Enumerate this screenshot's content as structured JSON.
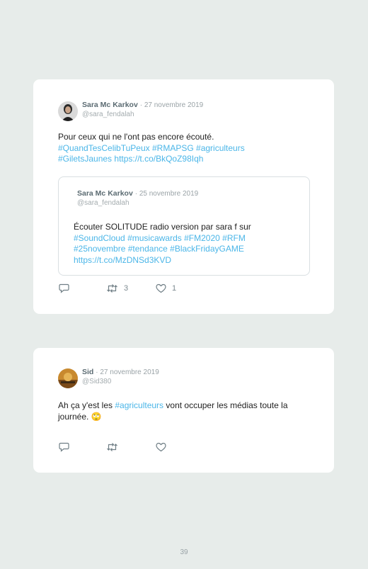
{
  "tweet1": {
    "name": "Sara Mc Karkov",
    "date": "· 27 novembre 2019",
    "handle": "@sara_fendalah",
    "text": "Pour ceux qui ne l'ont pas encore écouté.",
    "links": [
      "#QuandTesCelibTuPeux",
      "#RMAPSG",
      "#agriculteurs",
      "#GiletsJaunes",
      "https://t.co/BkQoZ98Iqh"
    ],
    "quoted": {
      "name": "Sara Mc Karkov",
      "date": "· 25 novembre 2019",
      "handle": "@sara_fendalah",
      "text": "Écouter SOLITUDE radio version par sara f sur",
      "links": [
        "#SoundCloud",
        "#musicawards",
        "#FM2020",
        "#RFM",
        "#25novembre",
        "#tendance",
        "#BlackFridayGAME",
        "https://t.co/MzDNSd3KVD"
      ]
    },
    "retweets": "3",
    "likes": "1"
  },
  "tweet2": {
    "name": "Sid",
    "date": "· 27 novembre 2019",
    "handle": "@Sid380",
    "text_before": "Ah ça y'est les",
    "hashtag": "#agriculteurs",
    "text_after": "vont occuper les médias toute la journée.",
    "emoji": "🙄"
  },
  "page_number": "39"
}
